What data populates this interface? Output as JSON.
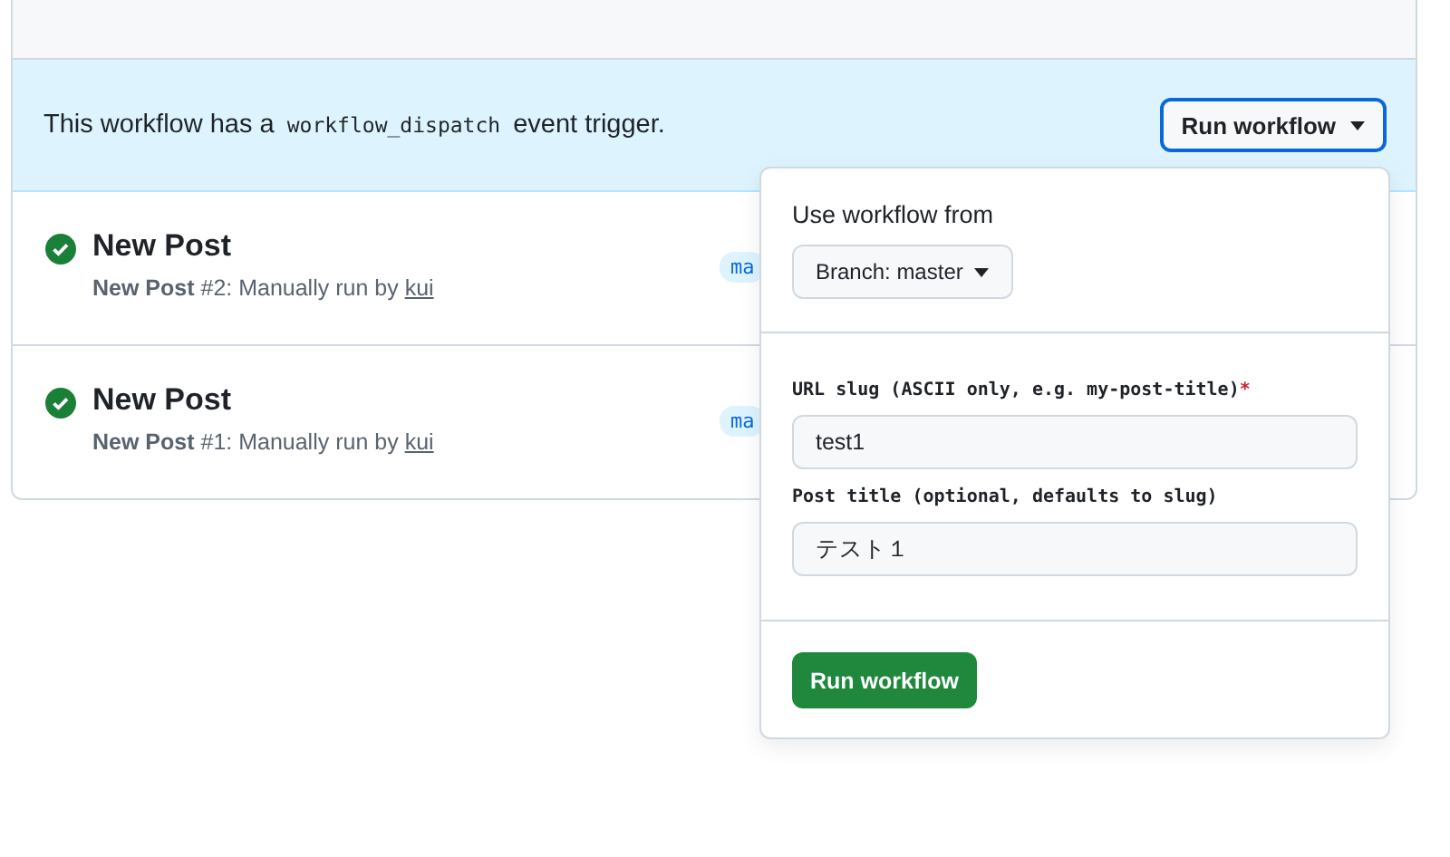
{
  "header": {
    "kind": "band"
  },
  "banner": {
    "text_before": "This workflow has a",
    "code": "workflow_dispatch",
    "text_after": "event trigger.",
    "button": "Run workflow"
  },
  "runs": [
    {
      "title": "New Post",
      "detail": "New Post",
      "number": "#2: Manually run by",
      "actor": "kui",
      "branch": "ma",
      "success": true
    },
    {
      "title": "New Post",
      "detail": "New Post",
      "number": "#1: Manually run by",
      "actor": "kui",
      "branch": "ma",
      "success": true
    }
  ],
  "popup": {
    "heading": "Use workflow from",
    "branch_button": "Branch: master",
    "inputs": [
      {
        "label": "URL slug (ASCII only, e.g. my-post-title)",
        "required": true,
        "value": "test1"
      },
      {
        "label": "Post title (optional, defaults to slug)",
        "required": false,
        "value": "テスト１"
      }
    ],
    "required_mark": "*",
    "submit": "Run workflow"
  }
}
